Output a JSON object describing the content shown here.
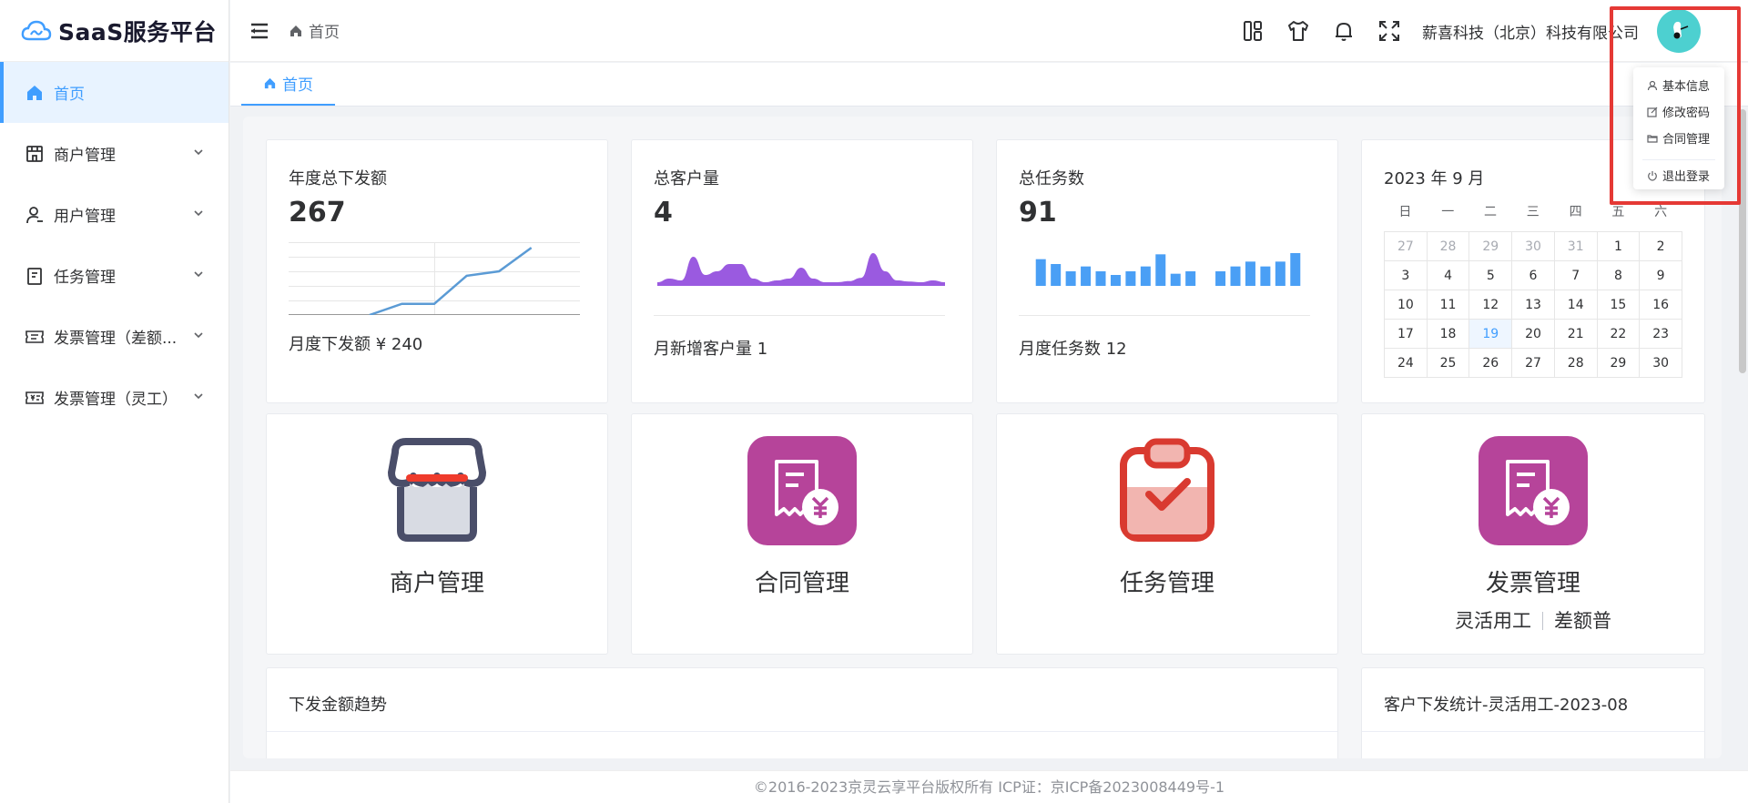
{
  "app": {
    "title": "SaaS服务平台"
  },
  "sidebar": {
    "items": [
      {
        "label": "首页",
        "icon": "home-icon"
      },
      {
        "label": "商户管理",
        "icon": "store-icon"
      },
      {
        "label": "用户管理",
        "icon": "user-icon"
      },
      {
        "label": "任务管理",
        "icon": "task-icon"
      },
      {
        "label": "发票管理（差额...",
        "icon": "invoice-icon"
      },
      {
        "label": "发票管理（灵工）",
        "icon": "invoice-yen-icon"
      }
    ]
  },
  "header": {
    "breadcrumb": "首页",
    "company": "薪喜科技（北京）科技有限公司"
  },
  "tabs": [
    {
      "label": "首页"
    }
  ],
  "stats": [
    {
      "title": "年度总下发额",
      "value": "267",
      "footer": "月度下发额 ¥ 240"
    },
    {
      "title": "总客户量",
      "value": "4",
      "footer": "月新增客户量 1"
    },
    {
      "title": "总任务数",
      "value": "91",
      "footer": "月度任务数 12"
    }
  ],
  "calendar": {
    "title": "2023 年 9 月",
    "weekdays": [
      "日",
      "一",
      "二",
      "三",
      "四",
      "五",
      "六"
    ],
    "days": [
      "27",
      "28",
      "29",
      "30",
      "31",
      "1",
      "2",
      "3",
      "4",
      "5",
      "6",
      "7",
      "8",
      "9",
      "10",
      "11",
      "12",
      "13",
      "14",
      "15",
      "16",
      "17",
      "18",
      "19",
      "20",
      "21",
      "22",
      "23",
      "24",
      "25",
      "26",
      "27",
      "28",
      "29",
      "30"
    ],
    "prev_month_count": 5,
    "today": "19"
  },
  "quick": [
    {
      "label": "商户管理",
      "icon": "store-front-icon"
    },
    {
      "label": "合同管理",
      "icon": "contract-receipt-icon"
    },
    {
      "label": "任务管理",
      "icon": "task-clipboard-icon"
    },
    {
      "label": "发票管理",
      "icon": "invoice-receipt-icon",
      "sub1": "灵活用工",
      "sub2": "差额普"
    }
  ],
  "sections": {
    "trend_title": "下发金额趋势",
    "customer_title": "客户下发统计-灵活用工-2023-08"
  },
  "footer": {
    "text": "©2016-2023京灵云享平台版权所有 ICP证：京ICP备2023008449号-1"
  },
  "dropdown": {
    "items": [
      {
        "label": "基本信息",
        "icon": "user-icon"
      },
      {
        "label": "修改密码",
        "icon": "edit-icon"
      },
      {
        "label": "合同管理",
        "icon": "folder-icon"
      },
      {
        "label": "退出登录",
        "icon": "power-icon"
      }
    ]
  },
  "colors": {
    "accent": "#409eff",
    "purple": "#9a5ae0",
    "bar_blue": "#4a9ff5",
    "magenta": "#b6449a",
    "red": "#d93a30",
    "highlight": "#e53935"
  },
  "chart_data": [
    {
      "type": "line",
      "title": "年度总下发额",
      "x": [
        1,
        2,
        3,
        4,
        5,
        6,
        7,
        8,
        9
      ],
      "series": [
        {
          "values": [
            null,
            null,
            0,
            20,
            20,
            70,
            78,
            120,
            null
          ]
        }
      ]
    },
    {
      "type": "area",
      "title": "总客户量",
      "series": [
        {
          "values": [
            1,
            2,
            1.5,
            8,
            3,
            4,
            6,
            6,
            2,
            1,
            1.5,
            2,
            5,
            2,
            1,
            1,
            1.3,
            2.2,
            9,
            4,
            1.5,
            1.2,
            1,
            1.5,
            1
          ]
        }
      ]
    },
    {
      "type": "bar",
      "title": "总任务数",
      "series": [
        {
          "values": [
            22,
            18,
            12,
            16,
            12,
            9,
            12,
            16,
            26,
            10,
            12,
            0,
            12,
            16,
            20,
            16,
            20,
            27
          ]
        }
      ]
    }
  ]
}
